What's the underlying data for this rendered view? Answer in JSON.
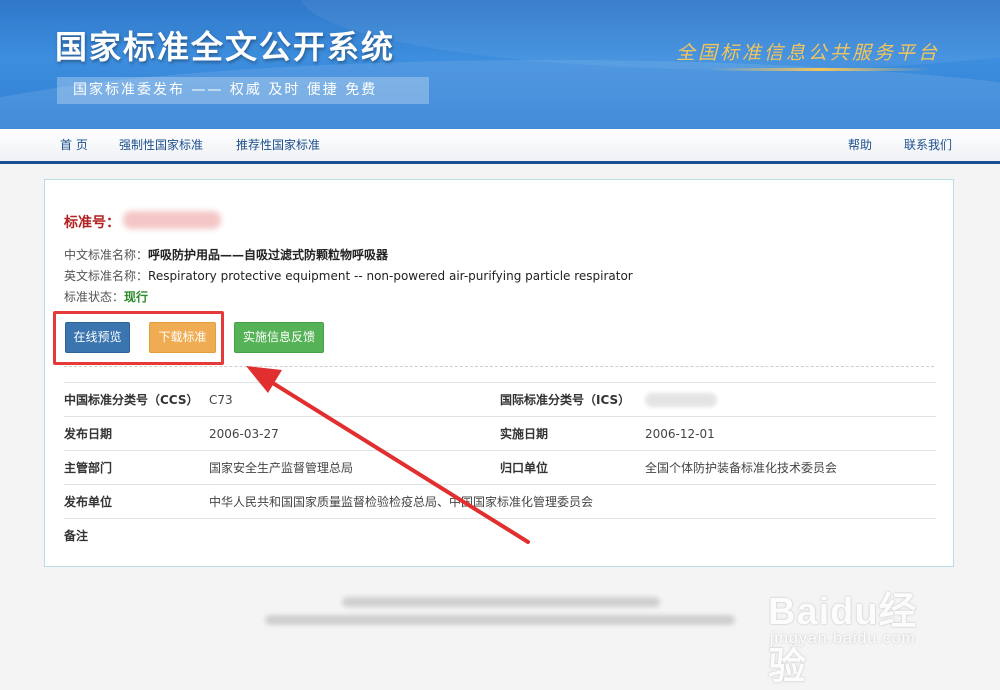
{
  "banner": {
    "title": "国家标准全文公开系统",
    "subtitle": "国家标准委发布 —— 权威 及时 便捷 免费",
    "slogan": "全国标准信息公共服务平台"
  },
  "nav": {
    "left": [
      "首 页",
      "强制性国家标准",
      "推荐性国家标准"
    ],
    "right": [
      "帮助",
      "联系我们"
    ]
  },
  "standard": {
    "number_label": "标准号：",
    "cn_name_label": "中文标准名称：",
    "cn_name": "呼吸防护用品——自吸过滤式防颗粒物呼吸器",
    "en_name_label": "英文标准名称：",
    "en_name": "Respiratory protective equipment -- non-powered air-purifying particle respirator",
    "status_label": "标准状态：",
    "status": "现行"
  },
  "buttons": {
    "preview": "在线预览",
    "download": "下载标准",
    "feedback": "实施信息反馈"
  },
  "meta": {
    "ccs_label": "中国标准分类号（CCS）",
    "ccs_value": "C73",
    "ics_label": "国际标准分类号（ICS）",
    "publish_date_label": "发布日期",
    "publish_date": "2006-03-27",
    "impl_date_label": "实施日期",
    "impl_date": "2006-12-01",
    "dept_label": "主管部门",
    "dept": "国家安全生产监督管理总局",
    "owner_label": "归口单位",
    "owner": "全国个体防护装备标准化技术委员会",
    "issuer_label": "发布单位",
    "issuer": "中华人民共和国国家质量监督检验检疫总局、中国国家标准化管理委员会",
    "remark_label": "备注"
  },
  "watermark": {
    "brand": "Baidu经验",
    "url": "jingyan.baidu.com"
  },
  "colors": {
    "banner_blue": "#3d8ede",
    "nav_text": "#1d4f8d",
    "annotation_red": "#e53a3a",
    "btn_preview": "#3a75b0",
    "btn_download": "#efac52",
    "btn_feedback": "#56b256"
  }
}
